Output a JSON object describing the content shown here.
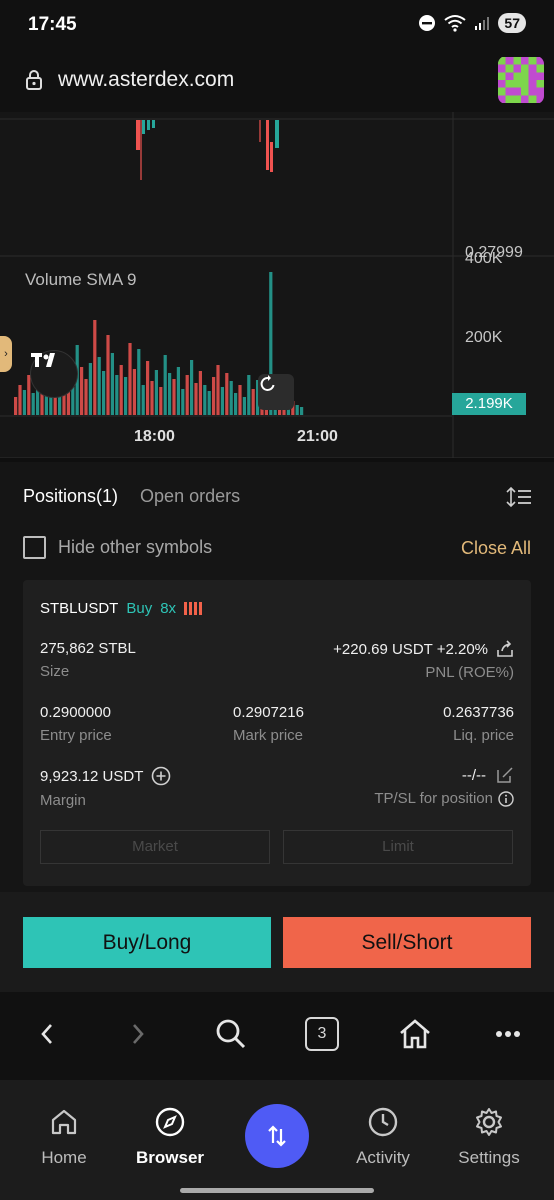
{
  "status": {
    "time": "17:45",
    "battery": "57"
  },
  "browser": {
    "url": "www.asterdex.com",
    "tab_count": "3"
  },
  "chart": {
    "price_label": "0.27999",
    "volume_indicator": "Volume SMA 9",
    "y_axis_labels": [
      "400K",
      "200K"
    ],
    "current_volume": "2.199K",
    "time_labels": [
      "18:00",
      "21:00"
    ],
    "colors": {
      "up": "#26a69a",
      "down": "#ef5350"
    }
  },
  "positions": {
    "tab_positions": "Positions(1)",
    "tab_open_orders": "Open orders",
    "hide_other_symbols": "Hide other symbols",
    "close_all": "Close All",
    "position": {
      "symbol": "STBLUSDT",
      "side": "Buy",
      "leverage": "8x",
      "size_value": "275,862 STBL",
      "size_label": "Size",
      "pnl_value": "+220.69 USDT +2.20%",
      "pnl_label": "PNL (ROE%)",
      "entry_price": "0.2900000",
      "entry_label": "Entry price",
      "mark_price": "0.2907216",
      "mark_label": "Mark price",
      "liq_price": "0.2637736",
      "liq_label": "Liq. price",
      "margin_value": "9,923.12 USDT",
      "margin_label": "Margin",
      "tpsl_value": "--/--",
      "tpsl_label": "TP/SL for position",
      "market_btn": "Market",
      "limit_btn": "Limit"
    }
  },
  "actions": {
    "buy": "Buy/Long",
    "sell": "Sell/Short"
  },
  "bottom_nav": {
    "home": "Home",
    "browser": "Browser",
    "activity": "Activity",
    "settings": "Settings"
  }
}
